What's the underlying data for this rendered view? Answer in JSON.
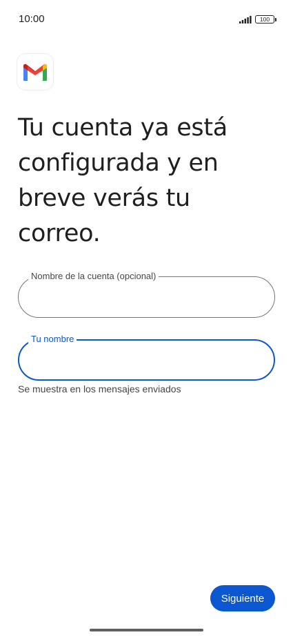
{
  "status_bar": {
    "time": "10:00",
    "battery_level": "100",
    "signal_icon": "cellular-signal-icon"
  },
  "app": {
    "logo_icon": "gmail-logo-icon",
    "colors": {
      "accent": "#0b57d0",
      "gmail_red": "#ea4335",
      "gmail_blue": "#4285f4",
      "gmail_green": "#34a853",
      "gmail_yellow": "#fbbc04",
      "gmail_dark_red": "#c5221f"
    }
  },
  "main": {
    "headline": "Tu cuenta ya está configurada y en breve verás tu correo.",
    "account_field": {
      "label": "Nombre de la cuenta (opcional)",
      "value": ""
    },
    "name_field": {
      "label": "Tu nombre",
      "value": "",
      "focused": true
    },
    "helper_text": "Se muestra en los mensajes enviados"
  },
  "footer": {
    "next_label": "Siguiente"
  }
}
